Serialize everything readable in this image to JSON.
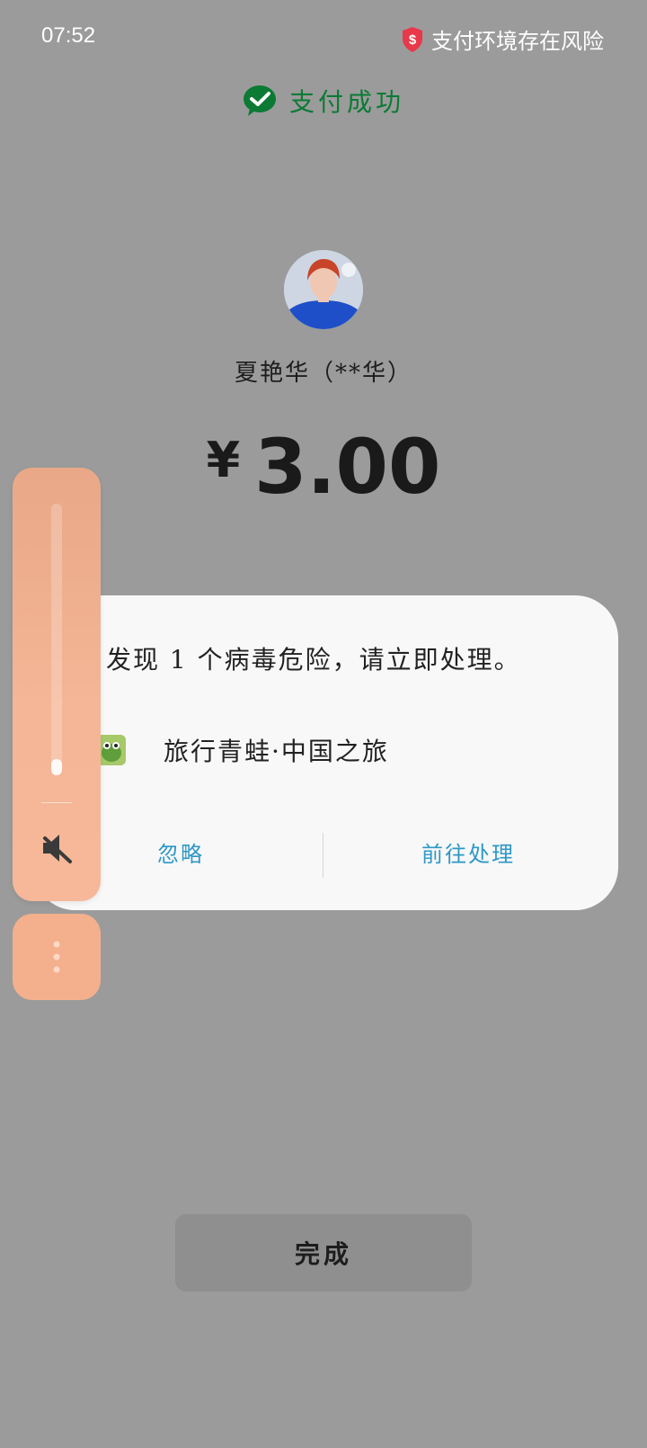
{
  "status_bar": {
    "time": "07:52",
    "risk_text": "支付环境存在风险",
    "risk_icon": "shield-dollar-icon",
    "risk_icon_color": "#e8384a"
  },
  "header": {
    "title": "支付成功",
    "icon": "wechat-pay-check-icon",
    "accent_color": "#0b7a34"
  },
  "payee": {
    "name": "夏艳华（**华）"
  },
  "amount": {
    "currency": "¥",
    "value": "3.00"
  },
  "dialog": {
    "message": "发现 1 个病毒危险，请立即处理。",
    "app_name": "旅行青蛙·中国之旅",
    "ignore_label": "忽略",
    "go_label": "前往处理",
    "button_color": "#2e98c5"
  },
  "volume": {
    "level": 0.06,
    "mute_icon": "speaker-mute-icon",
    "more_icon": "more-vertical-icon"
  },
  "footer": {
    "done_label": "完成"
  }
}
